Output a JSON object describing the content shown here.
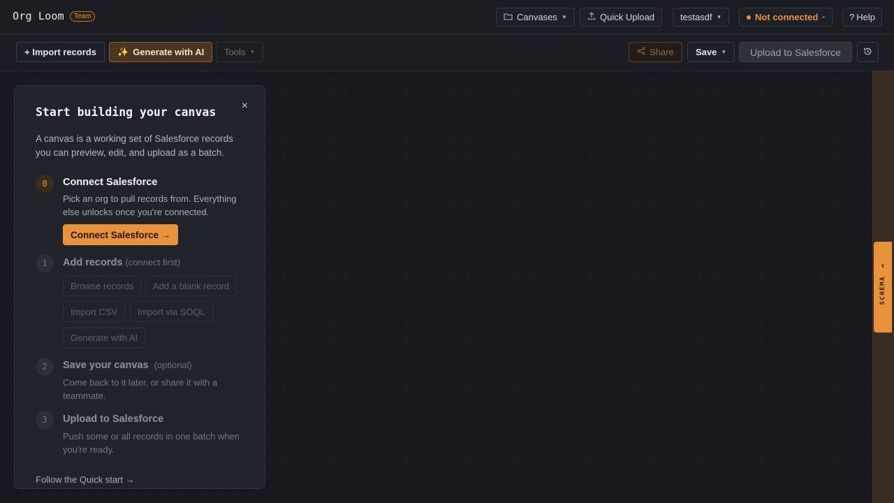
{
  "app": {
    "name": "Org Loom",
    "badge": "Team"
  },
  "header": {
    "canvases_label": "Canvases",
    "quick_upload_label": "Quick Upload",
    "org_name": "testasdf",
    "connection_status": "Not connected",
    "help_label": "Help"
  },
  "toolbar": {
    "import_label": "+ Import records",
    "generate_label": "Generate with AI",
    "tools_label": "Tools",
    "share_label": "Share",
    "save_label": "Save",
    "upload_label": "Upload to Salesforce"
  },
  "panel": {
    "title": "Start building your canvas",
    "intro": "A canvas is a working set of Salesforce records you can preview, edit, and upload as a batch.",
    "steps": [
      {
        "num": "0",
        "title": "Connect Salesforce",
        "subtitle": "",
        "desc": "Pick an org to pull records from. Everything else unlocks once you're connected.",
        "action": "Connect Salesforce →"
      },
      {
        "num": "1",
        "title": "Add records",
        "subtitle": "(connect first)",
        "chips": [
          "Browse records",
          "Add a blank record",
          "Import CSV",
          "Import via SOQL",
          "Generate with AI"
        ]
      },
      {
        "num": "2",
        "title": "Save your canvas",
        "subtitle": "(optional)",
        "desc": "Come back to it later, or share it with a teammate."
      },
      {
        "num": "3",
        "title": "Upload to Salesforce",
        "subtitle": "",
        "desc": "Push some or all records in one batch when you're ready."
      }
    ],
    "quick_start": "Follow the Quick start →"
  },
  "schema_panel": {
    "label": "SCHEMA"
  },
  "colors": {
    "accent": "#e8923a",
    "background": "#16181d"
  }
}
